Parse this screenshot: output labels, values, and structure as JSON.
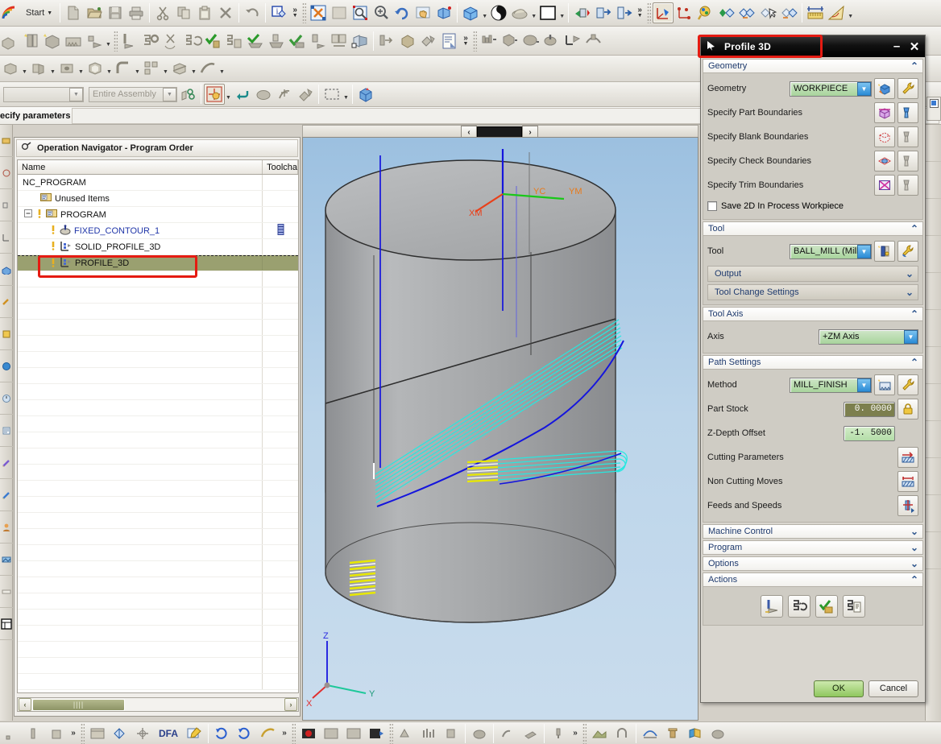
{
  "app": {
    "start_label": "Start",
    "cue_text": "ecify parameters",
    "assembly_filter": "Entire Assembly"
  },
  "navigator": {
    "title": "Operation Navigator - Program Order",
    "columns": [
      "Name",
      "Toolcha"
    ],
    "rows": [
      {
        "label": "NC_PROGRAM",
        "indent": 0,
        "icon": "none",
        "selected": false,
        "blue": false,
        "toolchange": false,
        "expander": "none",
        "warn": false
      },
      {
        "label": "Unused Items",
        "indent": 1,
        "icon": "folder-icon",
        "selected": false,
        "blue": false,
        "toolchange": false,
        "expander": "none",
        "warn": false
      },
      {
        "label": "PROGRAM",
        "indent": 1,
        "icon": "folder-icon",
        "selected": false,
        "blue": false,
        "toolchange": false,
        "expander": "minus",
        "warn": true
      },
      {
        "label": "FIXED_CONTOUR_1",
        "indent": 2,
        "icon": "contour-op-icon",
        "selected": false,
        "blue": true,
        "toolchange": true,
        "expander": "none",
        "warn": true
      },
      {
        "label": "SOLID_PROFILE_3D",
        "indent": 2,
        "icon": "profile-op-icon",
        "selected": false,
        "blue": false,
        "toolchange": false,
        "expander": "none",
        "warn": true
      },
      {
        "label": "PROFILE_3D",
        "indent": 2,
        "icon": "profile-op-icon",
        "selected": true,
        "blue": false,
        "toolchange": false,
        "expander": "none",
        "warn": true
      }
    ],
    "scroll_left_label": "‹",
    "scroll_right_label": "›"
  },
  "viewport": {
    "wcs_labels": {
      "x": "XM",
      "y": "YM",
      "c": "YC"
    },
    "triad_labels": {
      "x": "X",
      "y": "Y",
      "z": "Z"
    },
    "split_left": "‹",
    "split_right": "›"
  },
  "dialog": {
    "title": "Profile 3D",
    "minimize_label": "–",
    "close_label": "✕",
    "collapse_up": "⌃",
    "collapse_down": "⌄",
    "sections": {
      "geometry": {
        "header": "Geometry",
        "geometry_label": "Geometry",
        "geometry_value": "WORKPIECE",
        "rows": [
          {
            "label": "Specify Part Boundaries",
            "icon": "part-boundary-icon"
          },
          {
            "label": "Specify Blank Boundaries",
            "icon": "blank-boundary-icon"
          },
          {
            "label": "Specify Check Boundaries",
            "icon": "check-boundary-icon"
          },
          {
            "label": "Specify Trim Boundaries",
            "icon": "trim-boundary-icon"
          }
        ],
        "checkbox_label": "Save 2D In Process Workpiece",
        "checkbox_checked": false
      },
      "tool": {
        "header": "Tool",
        "tool_label": "Tool",
        "tool_value": "BALL_MILL (Mill",
        "subbars": [
          "Output",
          "Tool Change Settings"
        ]
      },
      "tool_axis": {
        "header": "Tool Axis",
        "axis_label": "Axis",
        "axis_value": "+ZM Axis"
      },
      "path_settings": {
        "header": "Path Settings",
        "method_label": "Method",
        "method_value": "MILL_FINISH",
        "part_stock_label": "Part Stock",
        "part_stock_value": "0. 0000",
        "z_depth_label": "Z-Depth Offset",
        "z_depth_value": "-1. 5000",
        "rows": [
          {
            "label": "Cutting Parameters",
            "icon": "cutting-parameters-icon"
          },
          {
            "label": "Non Cutting Moves",
            "icon": "non-cutting-moves-icon"
          },
          {
            "label": "Feeds and Speeds",
            "icon": "feeds-speeds-icon"
          }
        ]
      },
      "machine_control": {
        "header": "Machine Control"
      },
      "program": {
        "header": "Program"
      },
      "options": {
        "header": "Options"
      },
      "actions": {
        "header": "Actions",
        "buttons": [
          "generate-icon",
          "replay-icon",
          "verify-icon",
          "list-icon"
        ]
      }
    },
    "ok_label": "OK",
    "cancel_label": "Cancel"
  },
  "colors": {
    "dialog_title_bg": "#000000",
    "combo_green": "#a8d49c",
    "selection_olive": "#9aa070",
    "annotation_red": "#e51b12",
    "viewport_sky": "#9cc0e0",
    "toolpath_cyan": "#26e8e0",
    "toolpath_blue": "#1515dd",
    "toolpath_yellow": "#e8e800"
  }
}
